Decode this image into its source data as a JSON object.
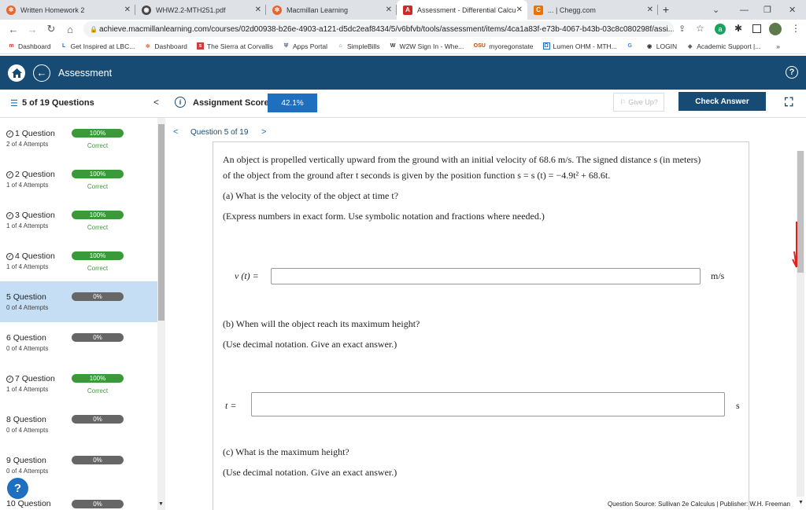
{
  "browser": {
    "tabs": [
      {
        "title": "Written Homework 2",
        "icon": "macmillan-icon",
        "color": "#e8662d"
      },
      {
        "title": "WHW2.2-MTH251.pdf",
        "icon": "pdf-globe-icon",
        "color": "#444444"
      },
      {
        "title": "Macmillan Learning",
        "icon": "macmillan-icon",
        "color": "#e8662d"
      },
      {
        "title": "Assessment - Differential Calcu",
        "icon": "achieve-icon",
        "color": "#cc2b2b"
      },
      {
        "title": "... | Chegg.com",
        "icon": "chegg-icon",
        "color": "#eb7100"
      }
    ],
    "url": "achieve.macmillanlearning.com/courses/02d00938-b26e-4903-a121-d5dc2eaf8434/5/v6bfvb/tools/assessment/items/4ca1a83f-e73b-4067-b43b-03c8c080298f/assi...",
    "bookmarks": [
      "Dashboard",
      "Get Inspired at LBC...",
      "Dashboard",
      "The Sierra at Corvallis",
      "Apps Portal",
      "SimpleBills",
      "W2W Sign In - Whe...",
      "myoregonstate",
      "Lumen OHM - MTH...",
      "LOGIN",
      "Academic Support |..."
    ],
    "bookmark_more": "»"
  },
  "app": {
    "header_title": "Assessment",
    "help_icon": "?"
  },
  "subheader": {
    "questions_count": "5 of 19 Questions",
    "score_label": "Assignment Score:",
    "score_value": "42.1%",
    "give_up": "Give Up?",
    "check_answer": "Check Answer"
  },
  "sidebar": {
    "questions": [
      {
        "name": "1 Question",
        "attempts": "2 of 4 Attempts",
        "progress": "100%",
        "status": "Correct",
        "done": true
      },
      {
        "name": "2 Question",
        "attempts": "1 of 4 Attempts",
        "progress": "100%",
        "status": "Correct",
        "done": true
      },
      {
        "name": "3 Question",
        "attempts": "1 of 4 Attempts",
        "progress": "100%",
        "status": "Correct",
        "done": true
      },
      {
        "name": "4 Question",
        "attempts": "1 of 4 Attempts",
        "progress": "100%",
        "status": "Correct",
        "done": true
      },
      {
        "name": "5 Question",
        "attempts": "0 of 4 Attempts",
        "progress": "0%",
        "status": "",
        "done": false
      },
      {
        "name": "6 Question",
        "attempts": "0 of 4 Attempts",
        "progress": "0%",
        "status": "",
        "done": false
      },
      {
        "name": "7 Question",
        "attempts": "1 of 4 Attempts",
        "progress": "100%",
        "status": "Correct",
        "done": true
      },
      {
        "name": "8 Question",
        "attempts": "0 of 4 Attempts",
        "progress": "0%",
        "status": "",
        "done": false
      },
      {
        "name": "9 Question",
        "attempts": "0 of 4 Attempts",
        "progress": "0%",
        "status": "",
        "done": false
      },
      {
        "name": "10 Question",
        "attempts": "",
        "progress": "0%",
        "status": "",
        "done": false
      }
    ],
    "help_bubble": "?"
  },
  "question": {
    "nav_label": "Question 5 of 19",
    "prev": "<",
    "next": ">",
    "intro_line1": "An object is propelled vertically upward from the ground with an initial velocity of 68.6 m/s. The signed distance s (in meters)",
    "intro_line2": "of the object from the ground after t seconds is given by the position function s = s (t) = −4.9t² + 68.6t.",
    "part_a": "(a) What is the velocity of the object at time t?",
    "part_a_note": "(Express numbers in exact form. Use symbolic notation and fractions where needed.)",
    "answer_a_label": "v (t) =",
    "answer_a_unit": "m/s",
    "answer_a_value": "",
    "part_b": "(b) When will the object reach its maximum height?",
    "part_b_note": "(Use decimal notation. Give an exact answer.)",
    "answer_b_label": "t =",
    "answer_b_unit": "s",
    "answer_b_value": "",
    "part_c": "(c) What is the maximum height?",
    "part_c_note": "(Use decimal notation. Give an exact answer.)",
    "source": "Question Source: Sullivan 2e Calculus  |  Publisher: W.H. Freeman"
  }
}
